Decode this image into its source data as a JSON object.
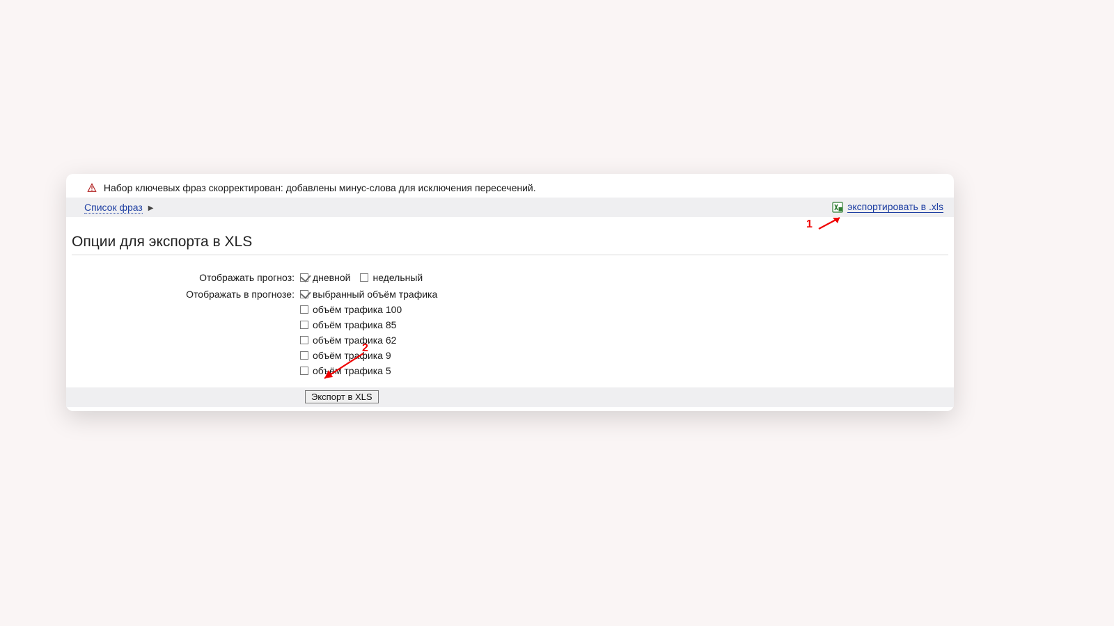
{
  "warning": {
    "text": "Набор ключевых фраз скорректирован: добавлены минус-слова для исключения пересечений."
  },
  "toolbar": {
    "phrases_link_label": "Список фраз",
    "export_link_label": "экспортировать в .xls"
  },
  "section_title": "Опции для экспорта в XLS",
  "forecast_row": {
    "label": "Отображать прогноз:",
    "items": [
      {
        "label": "дневной",
        "checked": true
      },
      {
        "label": "недельный",
        "checked": false
      }
    ]
  },
  "in_forecast_row": {
    "label": "Отображать в прогнозе:",
    "items": [
      {
        "label": "выбранный объём трафика",
        "checked": true
      },
      {
        "label": "объём трафика 100",
        "checked": false
      },
      {
        "label": "объём трафика 85",
        "checked": false
      },
      {
        "label": "объём трафика 62",
        "checked": false
      },
      {
        "label": "объём трафика 9",
        "checked": false
      },
      {
        "label": "объём трафика 5",
        "checked": false
      }
    ]
  },
  "export_button_label": "Экспорт в XLS",
  "annotations": {
    "one": "1",
    "two": "2"
  }
}
